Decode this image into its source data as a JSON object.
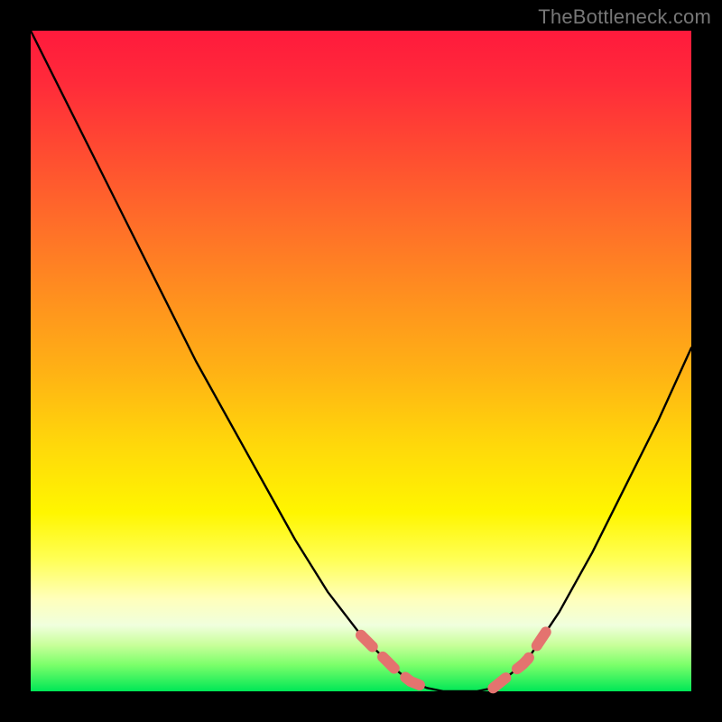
{
  "watermark": "TheBottleneck.com",
  "chart_data": {
    "type": "line",
    "title": "",
    "xlabel": "",
    "ylabel": "",
    "xlim": [
      0,
      1
    ],
    "ylim": [
      0,
      1
    ],
    "series": [
      {
        "name": "curve",
        "x": [
          0.0,
          0.05,
          0.1,
          0.15,
          0.2,
          0.25,
          0.3,
          0.35,
          0.4,
          0.45,
          0.5,
          0.55,
          0.575,
          0.6,
          0.625,
          0.65,
          0.675,
          0.7,
          0.75,
          0.8,
          0.85,
          0.9,
          0.95,
          1.0
        ],
        "y": [
          1.0,
          0.9,
          0.8,
          0.7,
          0.6,
          0.5,
          0.41,
          0.32,
          0.23,
          0.15,
          0.085,
          0.035,
          0.015,
          0.005,
          0.0,
          0.0,
          0.0,
          0.005,
          0.045,
          0.12,
          0.21,
          0.31,
          0.41,
          0.52
        ]
      }
    ],
    "dash_segments": {
      "left": {
        "x_start": 0.5,
        "x_end": 0.6
      },
      "right": {
        "x_start": 0.7,
        "x_end": 0.79
      }
    },
    "colors": {
      "curve": "#000000",
      "dash": "#e4736f"
    }
  }
}
